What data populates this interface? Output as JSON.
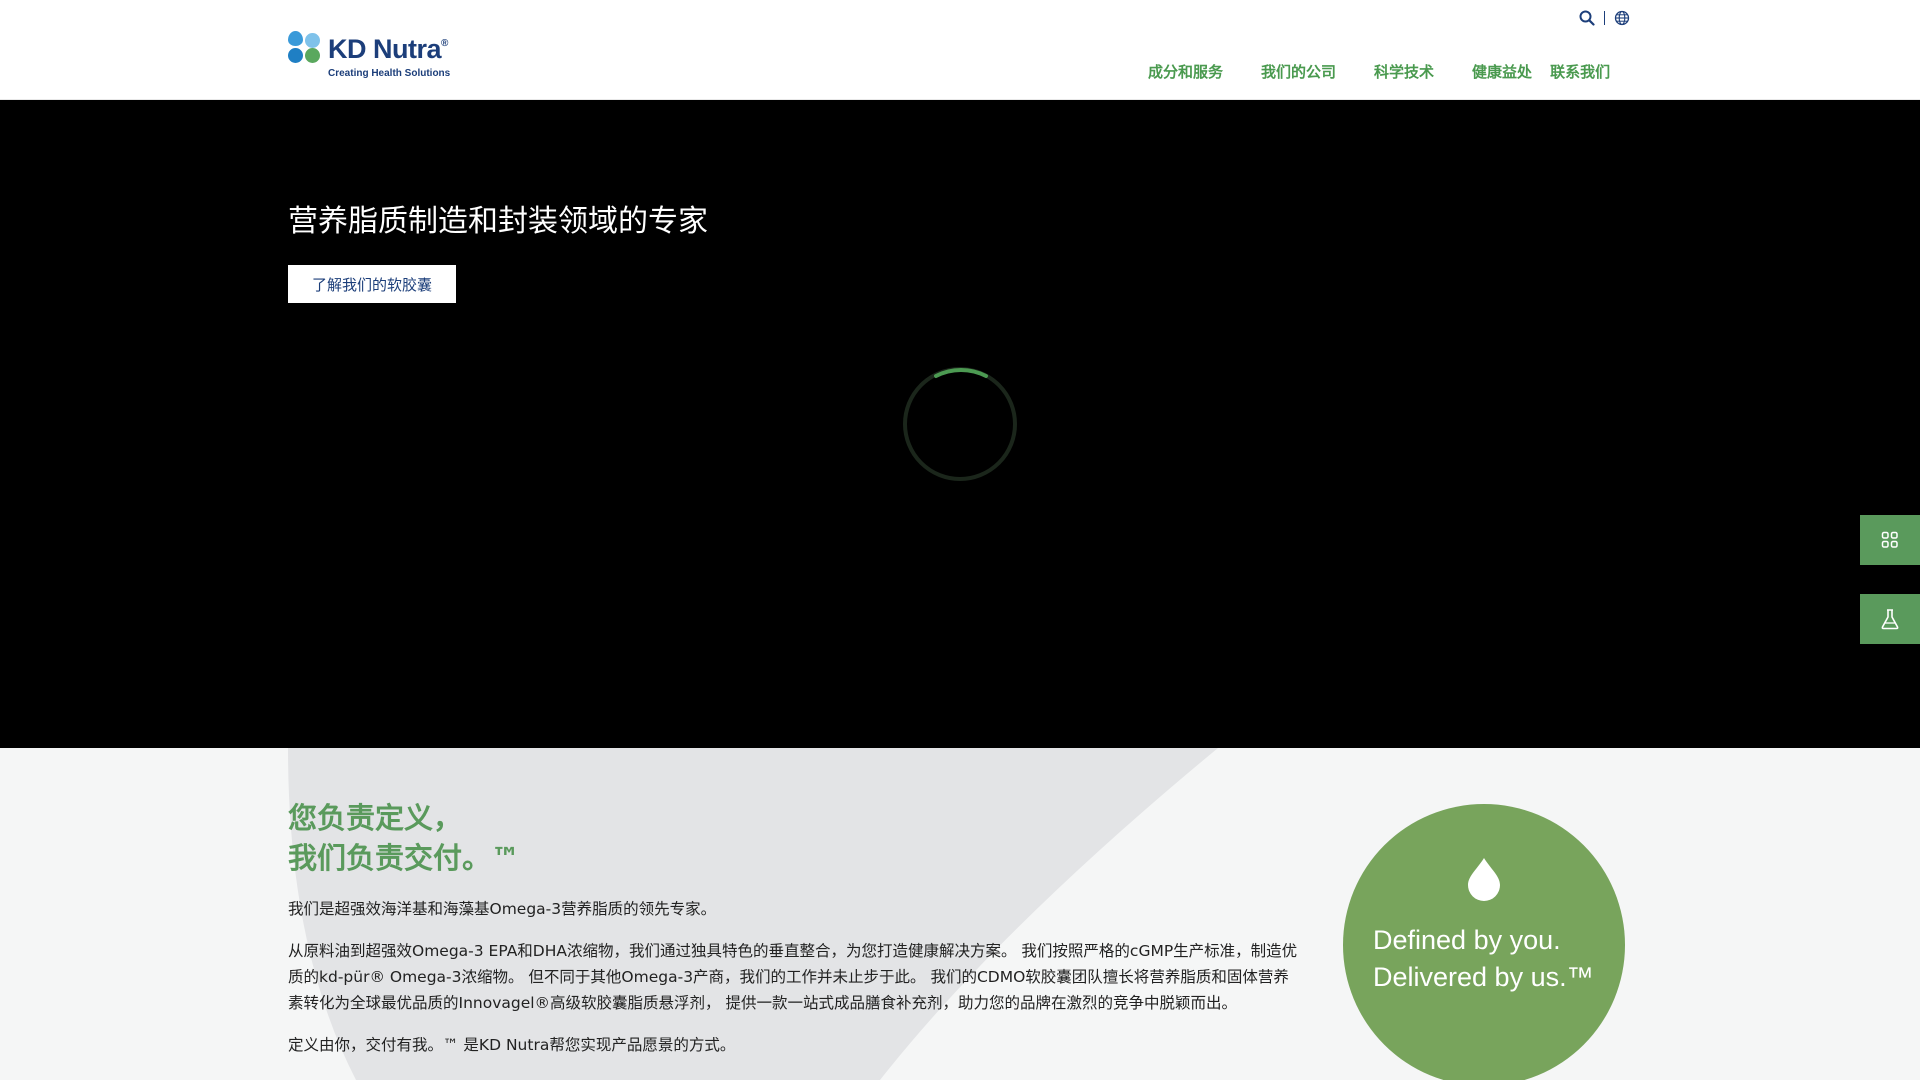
{
  "header": {
    "logo": {
      "brand": "KD Nutra",
      "registered": "®",
      "tagline": "Creating Health Solutions"
    },
    "utility": {
      "search_icon": "search-icon",
      "language_icon": "globe-icon"
    },
    "nav": [
      {
        "label": "成分和服务"
      },
      {
        "label": "我们的公司"
      },
      {
        "label": "科学技术"
      },
      {
        "label": "健康益处"
      },
      {
        "label": "联系我们"
      }
    ]
  },
  "hero": {
    "title": "营养脂质制造和封装领域的专家",
    "cta_label": "了解我们的软胶囊",
    "loading_icon": "spinner-icon"
  },
  "side_buttons": [
    {
      "icon": "grid-icon"
    },
    {
      "icon": "flask-icon"
    }
  ],
  "intro": {
    "heading_line1": "您负责定义，",
    "heading_line2": "我们负责交付。™",
    "paragraph1": "我们是超强效海洋基和海藻基Omega-3营养脂质的领先专家。",
    "paragraph2": "从原料油到超强效Omega-3 EPA和DHA浓缩物，我们通过独具特色的垂直整合，为您打造健康解决方案。 我们按照严格的cGMP生产标准，制造优质的kd-pür® Omega-3浓缩物。 但不同于其他Omega-3产商，我们的工作并未止步于此。 我们的CDMO软胶囊团队擅长将营养脂质和固体营养素转化为全球最优品质的Innovagel®高级软胶囊脂质悬浮剂， 提供一款一站式成品膳食补充剂，助力您的品牌在激烈的竞争中脱颖而出。",
    "paragraph3": "定义由你，交付有我。™ 是KD Nutra帮您实现产品愿景的方式。",
    "badge": {
      "line1": "Defined by you.",
      "line2": "Delivered by us.™",
      "icon": "drop-icon"
    }
  },
  "colors": {
    "brand_green": "#5a9a5c",
    "nav_green": "#4a9a4f",
    "badge_green": "#78a45c",
    "brand_blue": "#1c3e7a",
    "hero_bg": "#000000",
    "section_bg": "#f5f6f6"
  }
}
